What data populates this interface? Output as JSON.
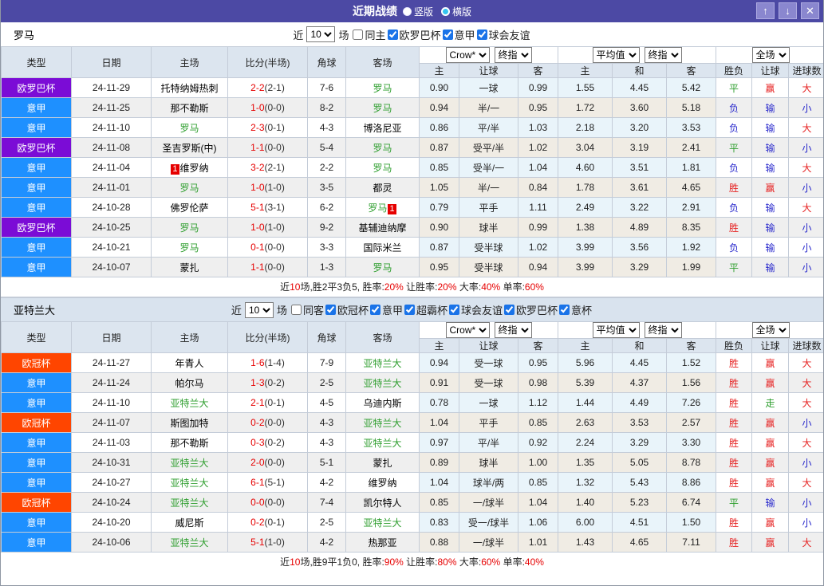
{
  "titlebar": {
    "title": "近期战绩",
    "radios": [
      {
        "label": "竖版",
        "selected": true
      },
      {
        "label": "横版",
        "selected": false
      }
    ],
    "up_icon": "↑",
    "down_icon": "↓",
    "close_icon": "✕"
  },
  "labels": {
    "near": "近",
    "games_unit": "场"
  },
  "columns": {
    "type": "类型",
    "date": "日期",
    "home": "主场",
    "score": "比分(半场)",
    "corner": "角球",
    "away": "客场",
    "odds_home": "主",
    "odds_handicap": "让球",
    "odds_away": "客",
    "avg_home": "主",
    "avg_draw": "和",
    "avg_away": "客",
    "res_wl": "胜负",
    "res_handicap": "让球",
    "res_goals": "进球数"
  },
  "selects": {
    "crow": "Crow*",
    "final_a": "终指",
    "average": "平均值",
    "final_b": "终指",
    "full": "全场"
  },
  "type_colors": {
    "欧罗巴杯": "#7b0cd6",
    "意甲": "#1e90ff",
    "欧冠杯": "#ff4500"
  },
  "teams": [
    {
      "name": "罗马",
      "games": "10",
      "filters": [
        {
          "label": "同主",
          "checked": false
        },
        {
          "label": "欧罗巴杯",
          "checked": true
        },
        {
          "label": "意甲",
          "checked": true
        },
        {
          "label": "球会友谊",
          "checked": true
        }
      ],
      "rows": [
        {
          "type": "欧罗巴杯",
          "date": "24-11-29",
          "home": "托特纳姆热刺",
          "home_focus": false,
          "home_badge": "",
          "score": "2-2",
          "half": "(2-1)",
          "corner": "7-6",
          "away": "罗马",
          "away_focus": true,
          "away_badge": "",
          "odds": [
            "0.90",
            "一球",
            "0.99"
          ],
          "avg": [
            "1.55",
            "4.45",
            "5.42"
          ],
          "res": [
            {
              "t": "平",
              "c": "g"
            },
            {
              "t": "赢",
              "c": "r"
            },
            {
              "t": "大",
              "c": "r"
            }
          ]
        },
        {
          "type": "意甲",
          "date": "24-11-25",
          "home": "那不勒斯",
          "home_focus": false,
          "home_badge": "",
          "score": "1-0",
          "half": "(0-0)",
          "corner": "8-2",
          "away": "罗马",
          "away_focus": true,
          "away_badge": "",
          "odds": [
            "0.94",
            "半/一",
            "0.95"
          ],
          "avg": [
            "1.72",
            "3.60",
            "5.18"
          ],
          "res": [
            {
              "t": "负",
              "c": "b"
            },
            {
              "t": "输",
              "c": "b"
            },
            {
              "t": "小",
              "c": "b"
            }
          ]
        },
        {
          "type": "意甲",
          "date": "24-11-10",
          "home": "罗马",
          "home_focus": true,
          "home_badge": "",
          "score": "2-3",
          "half": "(0-1)",
          "corner": "4-3",
          "away": "博洛尼亚",
          "away_focus": false,
          "away_badge": "",
          "odds": [
            "0.86",
            "平/半",
            "1.03"
          ],
          "avg": [
            "2.18",
            "3.20",
            "3.53"
          ],
          "res": [
            {
              "t": "负",
              "c": "b"
            },
            {
              "t": "输",
              "c": "b"
            },
            {
              "t": "大",
              "c": "r"
            }
          ]
        },
        {
          "type": "欧罗巴杯",
          "date": "24-11-08",
          "home": "圣吉罗斯(中)",
          "home_focus": false,
          "home_badge": "",
          "score": "1-1",
          "half": "(0-0)",
          "corner": "5-4",
          "away": "罗马",
          "away_focus": true,
          "away_badge": "",
          "odds": [
            "0.87",
            "受平/半",
            "1.02"
          ],
          "avg": [
            "3.04",
            "3.19",
            "2.41"
          ],
          "res": [
            {
              "t": "平",
              "c": "g"
            },
            {
              "t": "输",
              "c": "b"
            },
            {
              "t": "小",
              "c": "b"
            }
          ]
        },
        {
          "type": "意甲",
          "date": "24-11-04",
          "home": "维罗纳",
          "home_focus": false,
          "home_badge": "1",
          "score": "3-2",
          "half": "(2-1)",
          "corner": "2-2",
          "away": "罗马",
          "away_focus": true,
          "away_badge": "",
          "odds": [
            "0.85",
            "受半/一",
            "1.04"
          ],
          "avg": [
            "4.60",
            "3.51",
            "1.81"
          ],
          "res": [
            {
              "t": "负",
              "c": "b"
            },
            {
              "t": "输",
              "c": "b"
            },
            {
              "t": "大",
              "c": "r"
            }
          ]
        },
        {
          "type": "意甲",
          "date": "24-11-01",
          "home": "罗马",
          "home_focus": true,
          "home_badge": "",
          "score": "1-0",
          "half": "(1-0)",
          "corner": "3-5",
          "away": "都灵",
          "away_focus": false,
          "away_badge": "",
          "odds": [
            "1.05",
            "半/一",
            "0.84"
          ],
          "avg": [
            "1.78",
            "3.61",
            "4.65"
          ],
          "res": [
            {
              "t": "胜",
              "c": "r"
            },
            {
              "t": "赢",
              "c": "r"
            },
            {
              "t": "小",
              "c": "b"
            }
          ]
        },
        {
          "type": "意甲",
          "date": "24-10-28",
          "home": "佛罗伦萨",
          "home_focus": false,
          "home_badge": "",
          "score": "5-1",
          "half": "(3-1)",
          "corner": "6-2",
          "away": "罗马",
          "away_focus": true,
          "away_badge": "1",
          "odds": [
            "0.79",
            "平手",
            "1.11"
          ],
          "avg": [
            "2.49",
            "3.22",
            "2.91"
          ],
          "res": [
            {
              "t": "负",
              "c": "b"
            },
            {
              "t": "输",
              "c": "b"
            },
            {
              "t": "大",
              "c": "r"
            }
          ]
        },
        {
          "type": "欧罗巴杯",
          "date": "24-10-25",
          "home": "罗马",
          "home_focus": true,
          "home_badge": "",
          "score": "1-0",
          "half": "(1-0)",
          "corner": "9-2",
          "away": "基辅迪纳摩",
          "away_focus": false,
          "away_badge": "",
          "odds": [
            "0.90",
            "球半",
            "0.99"
          ],
          "avg": [
            "1.38",
            "4.89",
            "8.35"
          ],
          "res": [
            {
              "t": "胜",
              "c": "r"
            },
            {
              "t": "输",
              "c": "b"
            },
            {
              "t": "小",
              "c": "b"
            }
          ]
        },
        {
          "type": "意甲",
          "date": "24-10-21",
          "home": "罗马",
          "home_focus": true,
          "home_badge": "",
          "score": "0-1",
          "half": "(0-0)",
          "corner": "3-3",
          "away": "国际米兰",
          "away_focus": false,
          "away_badge": "",
          "odds": [
            "0.87",
            "受半球",
            "1.02"
          ],
          "avg": [
            "3.99",
            "3.56",
            "1.92"
          ],
          "res": [
            {
              "t": "负",
              "c": "b"
            },
            {
              "t": "输",
              "c": "b"
            },
            {
              "t": "小",
              "c": "b"
            }
          ]
        },
        {
          "type": "意甲",
          "date": "24-10-07",
          "home": "蒙扎",
          "home_focus": false,
          "home_badge": "",
          "score": "1-1",
          "half": "(0-0)",
          "corner": "1-3",
          "away": "罗马",
          "away_focus": true,
          "away_badge": "",
          "odds": [
            "0.95",
            "受半球",
            "0.94"
          ],
          "avg": [
            "3.99",
            "3.29",
            "1.99"
          ],
          "res": [
            {
              "t": "平",
              "c": "g"
            },
            {
              "t": "输",
              "c": "b"
            },
            {
              "t": "小",
              "c": "b"
            }
          ]
        }
      ],
      "summary": [
        {
          "t": "近"
        },
        {
          "t": "10",
          "red": true
        },
        {
          "t": "场,胜2平3负5, 胜率:"
        },
        {
          "t": "20%",
          "red": true
        },
        {
          "t": " 让胜率:"
        },
        {
          "t": "20%",
          "red": true
        },
        {
          "t": " 大率:"
        },
        {
          "t": "40%",
          "red": true
        },
        {
          "t": " 单率:"
        },
        {
          "t": "60%",
          "red": true
        }
      ]
    },
    {
      "name": "亚特兰大",
      "games": "10",
      "filters": [
        {
          "label": "同客",
          "checked": false
        },
        {
          "label": "欧冠杯",
          "checked": true
        },
        {
          "label": "意甲",
          "checked": true
        },
        {
          "label": "超霸杯",
          "checked": true
        },
        {
          "label": "球会友谊",
          "checked": true
        },
        {
          "label": "欧罗巴杯",
          "checked": true
        },
        {
          "label": "意杯",
          "checked": true
        }
      ],
      "rows": [
        {
          "type": "欧冠杯",
          "date": "24-11-27",
          "home": "年青人",
          "home_focus": false,
          "home_badge": "",
          "score": "1-6",
          "half": "(1-4)",
          "corner": "7-9",
          "away": "亚特兰大",
          "away_focus": true,
          "away_badge": "",
          "odds": [
            "0.94",
            "受一球",
            "0.95"
          ],
          "avg": [
            "5.96",
            "4.45",
            "1.52"
          ],
          "res": [
            {
              "t": "胜",
              "c": "r"
            },
            {
              "t": "赢",
              "c": "r"
            },
            {
              "t": "大",
              "c": "r"
            }
          ]
        },
        {
          "type": "意甲",
          "date": "24-11-24",
          "home": "帕尔马",
          "home_focus": false,
          "home_badge": "",
          "score": "1-3",
          "half": "(0-2)",
          "corner": "2-5",
          "away": "亚特兰大",
          "away_focus": true,
          "away_badge": "",
          "odds": [
            "0.91",
            "受一球",
            "0.98"
          ],
          "avg": [
            "5.39",
            "4.37",
            "1.56"
          ],
          "res": [
            {
              "t": "胜",
              "c": "r"
            },
            {
              "t": "赢",
              "c": "r"
            },
            {
              "t": "大",
              "c": "r"
            }
          ]
        },
        {
          "type": "意甲",
          "date": "24-11-10",
          "home": "亚特兰大",
          "home_focus": true,
          "home_badge": "",
          "score": "2-1",
          "half": "(0-1)",
          "corner": "4-5",
          "away": "乌迪内斯",
          "away_focus": false,
          "away_badge": "",
          "odds": [
            "0.78",
            "一球",
            "1.12"
          ],
          "avg": [
            "1.44",
            "4.49",
            "7.26"
          ],
          "res": [
            {
              "t": "胜",
              "c": "r"
            },
            {
              "t": "走",
              "c": "g"
            },
            {
              "t": "大",
              "c": "r"
            }
          ]
        },
        {
          "type": "欧冠杯",
          "date": "24-11-07",
          "home": "斯图加特",
          "home_focus": false,
          "home_badge": "",
          "score": "0-2",
          "half": "(0-0)",
          "corner": "4-3",
          "away": "亚特兰大",
          "away_focus": true,
          "away_badge": "",
          "odds": [
            "1.04",
            "平手",
            "0.85"
          ],
          "avg": [
            "2.63",
            "3.53",
            "2.57"
          ],
          "res": [
            {
              "t": "胜",
              "c": "r"
            },
            {
              "t": "赢",
              "c": "r"
            },
            {
              "t": "小",
              "c": "b"
            }
          ]
        },
        {
          "type": "意甲",
          "date": "24-11-03",
          "home": "那不勒斯",
          "home_focus": false,
          "home_badge": "",
          "score": "0-3",
          "half": "(0-2)",
          "corner": "4-3",
          "away": "亚特兰大",
          "away_focus": true,
          "away_badge": "",
          "odds": [
            "0.97",
            "平/半",
            "0.92"
          ],
          "avg": [
            "2.24",
            "3.29",
            "3.30"
          ],
          "res": [
            {
              "t": "胜",
              "c": "r"
            },
            {
              "t": "赢",
              "c": "r"
            },
            {
              "t": "大",
              "c": "r"
            }
          ]
        },
        {
          "type": "意甲",
          "date": "24-10-31",
          "home": "亚特兰大",
          "home_focus": true,
          "home_badge": "",
          "score": "2-0",
          "half": "(0-0)",
          "corner": "5-1",
          "away": "蒙扎",
          "away_focus": false,
          "away_badge": "",
          "odds": [
            "0.89",
            "球半",
            "1.00"
          ],
          "avg": [
            "1.35",
            "5.05",
            "8.78"
          ],
          "res": [
            {
              "t": "胜",
              "c": "r"
            },
            {
              "t": "赢",
              "c": "r"
            },
            {
              "t": "小",
              "c": "b"
            }
          ]
        },
        {
          "type": "意甲",
          "date": "24-10-27",
          "home": "亚特兰大",
          "home_focus": true,
          "home_badge": "",
          "score": "6-1",
          "half": "(5-1)",
          "corner": "4-2",
          "away": "维罗纳",
          "away_focus": false,
          "away_badge": "",
          "odds": [
            "1.04",
            "球半/两",
            "0.85"
          ],
          "avg": [
            "1.32",
            "5.43",
            "8.86"
          ],
          "res": [
            {
              "t": "胜",
              "c": "r"
            },
            {
              "t": "赢",
              "c": "r"
            },
            {
              "t": "大",
              "c": "r"
            }
          ]
        },
        {
          "type": "欧冠杯",
          "date": "24-10-24",
          "home": "亚特兰大",
          "home_focus": true,
          "home_badge": "",
          "score": "0-0",
          "half": "(0-0)",
          "corner": "7-4",
          "away": "凯尔特人",
          "away_focus": false,
          "away_badge": "",
          "odds": [
            "0.85",
            "一/球半",
            "1.04"
          ],
          "avg": [
            "1.40",
            "5.23",
            "6.74"
          ],
          "res": [
            {
              "t": "平",
              "c": "g"
            },
            {
              "t": "输",
              "c": "b"
            },
            {
              "t": "小",
              "c": "b"
            }
          ]
        },
        {
          "type": "意甲",
          "date": "24-10-20",
          "home": "威尼斯",
          "home_focus": false,
          "home_badge": "",
          "score": "0-2",
          "half": "(0-1)",
          "corner": "2-5",
          "away": "亚特兰大",
          "away_focus": true,
          "away_badge": "",
          "odds": [
            "0.83",
            "受一/球半",
            "1.06"
          ],
          "avg": [
            "6.00",
            "4.51",
            "1.50"
          ],
          "res": [
            {
              "t": "胜",
              "c": "r"
            },
            {
              "t": "赢",
              "c": "r"
            },
            {
              "t": "小",
              "c": "b"
            }
          ]
        },
        {
          "type": "意甲",
          "date": "24-10-06",
          "home": "亚特兰大",
          "home_focus": true,
          "home_badge": "",
          "score": "5-1",
          "half": "(1-0)",
          "corner": "4-2",
          "away": "热那亚",
          "away_focus": false,
          "away_badge": "",
          "odds": [
            "0.88",
            "一/球半",
            "1.01"
          ],
          "avg": [
            "1.43",
            "4.65",
            "7.11"
          ],
          "res": [
            {
              "t": "胜",
              "c": "r"
            },
            {
              "t": "赢",
              "c": "r"
            },
            {
              "t": "大",
              "c": "r"
            }
          ]
        }
      ],
      "summary": [
        {
          "t": "近"
        },
        {
          "t": "10",
          "red": true
        },
        {
          "t": "场,胜9平1负0, 胜率:"
        },
        {
          "t": "90%",
          "red": true
        },
        {
          "t": " 让胜率:"
        },
        {
          "t": "80%",
          "red": true
        },
        {
          "t": " 大率:"
        },
        {
          "t": "60%",
          "red": true
        },
        {
          "t": " 单率:"
        },
        {
          "t": "40%",
          "red": true
        }
      ]
    }
  ]
}
